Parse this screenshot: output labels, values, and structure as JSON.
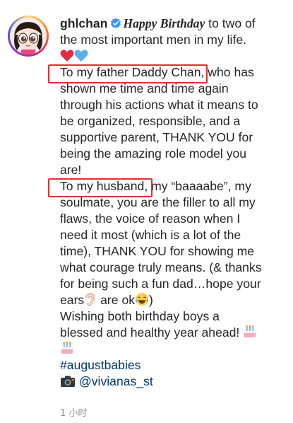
{
  "post": {
    "username": "ghlchan",
    "verified_icon": "verified-badge-icon",
    "avatar_icon": "cartoon-girl-avatar",
    "caption_lines": [
      {
        "before": " to two of",
        "script": "Happy Birthday"
      },
      "the most important men in my life.",
      "",
      {
        "highlighted": "To my father Daddy Chan,",
        "after": " who has"
      },
      "shown me time and time again",
      "through his actions what it means to",
      "be organized, responsible, and a",
      "supportive parent, THANK YOU for",
      "being the amazing role model you",
      "are!",
      {
        "highlighted": "To my husband,",
        "after": " my “baaaabe”, my"
      },
      "soulmate, you are the filler to all my",
      "flaws, the voice of reason when I",
      "need it most (which is a lot of the",
      "time), THANK YOU for showing me",
      "what courage truly means. (& thanks",
      "for being such a fun dad…hope your",
      {
        "before": "ears",
        "after": " are ok"
      },
      "Wishing both birthday boys a",
      "blessed and healthy year ahead!",
      "",
      "#augustbabies",
      "@vivianas_st"
    ],
    "hashtag": "#augustbabies",
    "mention": "@vivianas_st",
    "emojis": {
      "hearts": [
        "red-heart-icon",
        "blue-heart-icon"
      ],
      "ear": "ear-icon",
      "laugh": "tears-of-joy-icon",
      "cake": "birthday-cake-icon",
      "camera": "camera-icon"
    },
    "timestamp": "1 小时",
    "colors": {
      "text": "#262626",
      "link": "#00376b",
      "highlight_border": "#e0302f",
      "verified": "#3897f0",
      "timestamp": "#8e8e8e"
    }
  }
}
